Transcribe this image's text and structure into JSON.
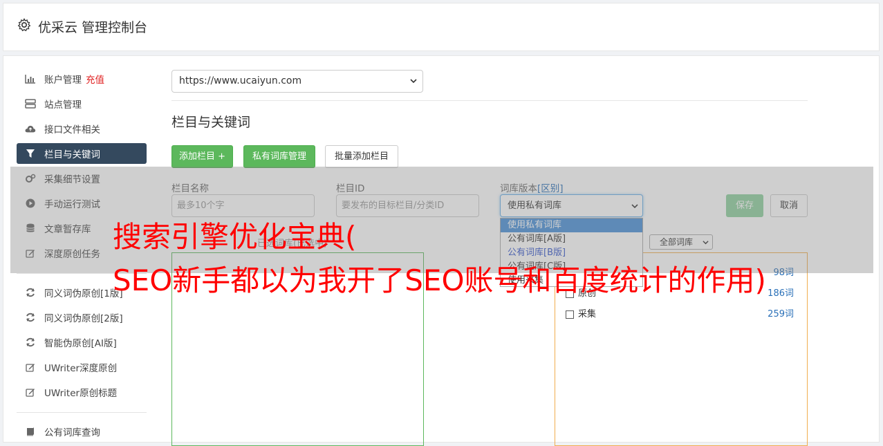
{
  "header": {
    "title": "优采云 管理控制台",
    "icon": "gear-icon"
  },
  "sidebar": {
    "items": [
      {
        "label": "账户管理",
        "extra": "充值",
        "icon": "bar-chart-icon"
      },
      {
        "label": "站点管理",
        "icon": "server-icon"
      },
      {
        "label": "接口文件相关",
        "icon": "cloud-upload-icon"
      },
      {
        "label": "栏目与关键词",
        "icon": "filter-icon",
        "active": true
      },
      {
        "label": "采集细节设置",
        "icon": "cogs-icon"
      },
      {
        "label": "手动运行测试",
        "icon": "play-circle-icon"
      },
      {
        "label": "文章暂存库",
        "icon": "database-icon"
      },
      {
        "label": "深度原创任务",
        "icon": "edit-icon"
      },
      {
        "label": "同义词伪原创[1版]",
        "icon": "refresh-icon"
      },
      {
        "label": "同义词伪原创[2版]",
        "icon": "refresh-icon"
      },
      {
        "label": "智能伪原创[AI版]",
        "icon": "refresh-icon"
      },
      {
        "label": "UWriter深度原创",
        "icon": "edit-icon"
      },
      {
        "label": "UWriter原创标题",
        "icon": "edit-icon"
      },
      {
        "label": "公有词库查询",
        "icon": "book-icon"
      }
    ]
  },
  "main": {
    "site_select": {
      "value": "https://www.ucaiyun.com"
    },
    "section_title": "栏目与关键词",
    "buttons": {
      "add_column": "添加栏目 +",
      "private_lib": "私有词库管理",
      "batch_add": "批量添加栏目",
      "save": "保存",
      "cancel": "取消"
    },
    "form": {
      "name_label": "栏目名称",
      "name_placeholder": "最多10个字",
      "id_label": "栏目ID",
      "id_placeholder": "要发布的目标栏目/分类ID",
      "version_label": "词库版本",
      "version_link": "[区别]",
      "version_value": "使用私有词库",
      "version_options": [
        "使用私有词库",
        "公有词库[A版]",
        "公有词库[B版]",
        "公有词库[C版]",
        "使用采集"
      ]
    },
    "selected_title": "已选词库(已选中)",
    "lib_filter": "全部词库",
    "libraries": [
      {
        "name": "",
        "count": "98词"
      },
      {
        "name": "原创",
        "count": "186词"
      },
      {
        "name": "采集",
        "count": "259词"
      }
    ]
  },
  "watermark": {
    "line1": "搜索引擎优化宝典(",
    "line2": "SEO新手都以为我开了SEO账号和百度统计的作用)"
  }
}
